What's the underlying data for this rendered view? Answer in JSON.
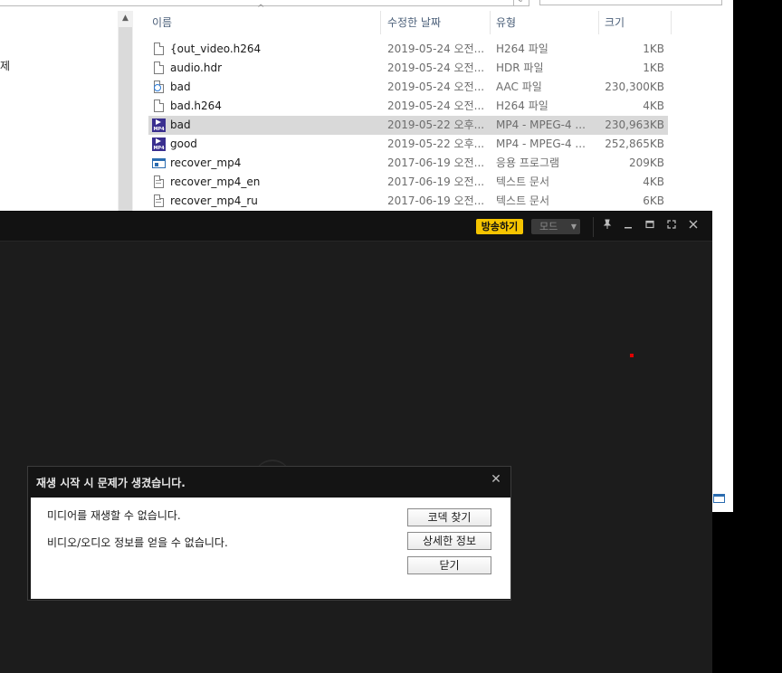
{
  "explorer": {
    "left_pane_text": "제",
    "columns": {
      "name": "이름",
      "modified": "수정한 날짜",
      "type": "유형",
      "size": "크기"
    },
    "files": [
      {
        "name": "{out_video.h264",
        "modified": "2019-05-24 오전...",
        "type": "H264 파일",
        "size": "1KB",
        "icon": "file-icon",
        "selected": false
      },
      {
        "name": "audio.hdr",
        "modified": "2019-05-24 오전...",
        "type": "HDR 파일",
        "size": "1KB",
        "icon": "file-icon",
        "selected": false
      },
      {
        "name": "bad",
        "modified": "2019-05-24 오전...",
        "type": "AAC 파일",
        "size": "230,300KB",
        "icon": "audio-file-icon",
        "selected": false
      },
      {
        "name": "bad.h264",
        "modified": "2019-05-24 오전...",
        "type": "H264 파일",
        "size": "4KB",
        "icon": "file-icon",
        "selected": false
      },
      {
        "name": "bad",
        "modified": "2019-05-22 오후...",
        "type": "MP4 - MPEG-4 ...",
        "size": "230,963KB",
        "icon": "mp4-icon",
        "selected": true
      },
      {
        "name": "good",
        "modified": "2019-05-22 오후...",
        "type": "MP4 - MPEG-4 ...",
        "size": "252,865KB",
        "icon": "mp4-icon",
        "selected": false
      },
      {
        "name": "recover_mp4",
        "modified": "2017-06-19 오전...",
        "type": "응용 프로그램",
        "size": "209KB",
        "icon": "application-icon",
        "selected": false
      },
      {
        "name": "recover_mp4_en",
        "modified": "2017-06-19 오전...",
        "type": "텍스트 문서",
        "size": "4KB",
        "icon": "text-file-icon",
        "selected": false
      },
      {
        "name": "recover_mp4_ru",
        "modified": "2017-06-19 오전...",
        "type": "텍스트 문서",
        "size": "6KB",
        "icon": "text-file-icon",
        "selected": false
      }
    ]
  },
  "player": {
    "broadcast_label": "방송하기",
    "mode_label": "모드",
    "title_icons": [
      "pin-icon",
      "minimize-icon",
      "maximize-icon",
      "fullscreen-icon",
      "close-icon"
    ]
  },
  "dialog": {
    "title": "재생 시작 시 문제가 생겼습니다.",
    "close_glyph": "✕",
    "message_1": "미디어를 재생할 수 없습니다.",
    "message_2": "비디오/오디오 정보를 얻을 수 없습니다.",
    "find_codec_label": "코덱 찾기",
    "details_label": "상세한 정보",
    "close_label": "닫기"
  },
  "colors": {
    "broadcast_yellow": "#f5c400",
    "selected_row": "#d9d9d9",
    "player_bg": "#1c1c1c"
  }
}
